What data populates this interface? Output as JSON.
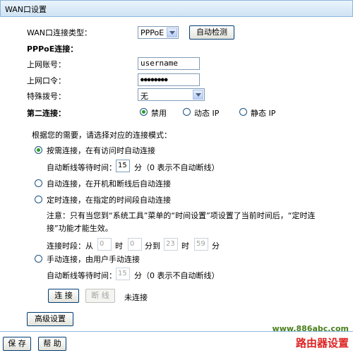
{
  "title": "WAN口设置",
  "conn_type": {
    "label": "WAN口连接类型：",
    "value": "PPPoE",
    "detect_button": "自动检测"
  },
  "pppoe": {
    "heading": "PPPoE连接：",
    "account_label": "上网账号：",
    "account_value": "username",
    "password_label": "上网口令：",
    "password_value": "●●●●●●●●",
    "dial_label": "特殊拨号：",
    "dial_value": "无"
  },
  "second": {
    "label": "第二连接：",
    "opt_disable": "禁用",
    "opt_dynamic": "动态 IP",
    "opt_static": "静态 IP",
    "selected": "禁用"
  },
  "mode_prompt": "根据您的需要，请选择对应的连接模式：",
  "mode1": {
    "label": "按需连接，在有访问时自动连接",
    "wait_label": "自动断线等待时间：",
    "wait_value": "15",
    "wait_unit": "分（0 表示不自动断线）"
  },
  "mode2": {
    "label": "自动连接，在开机和断线后自动连接"
  },
  "mode3": {
    "label": "定时连接，在指定的时间段自动连接",
    "note_line1": "注意：只有当您到“系统工具”菜单的“时间设置”项设置了当前时间后，“定时连",
    "note_line2": "接”功能才能生效。",
    "period_label": "连接时段：从",
    "from_h": "0",
    "hour1": "时",
    "from_m": "0",
    "to_label": "分到",
    "to_h": "23",
    "hour2": "时",
    "to_m": "59",
    "min2": "分"
  },
  "mode4": {
    "label": "手动连接，由用户手动连接",
    "wait_label": "自动断线等待时间：",
    "wait_value": "15",
    "wait_unit": "分（0 表示不自动断线）"
  },
  "actions": {
    "connect": "连 接",
    "disconnect": "断 线",
    "status": "未连接"
  },
  "advanced_button": "高级设置",
  "footer": {
    "save": "保 存",
    "help": "帮 助"
  },
  "watermark": {
    "site": "www.886abc.com",
    "text": "路由器设置"
  },
  "colors": {
    "accent": "#21a121",
    "border": "#8eb7dd"
  }
}
